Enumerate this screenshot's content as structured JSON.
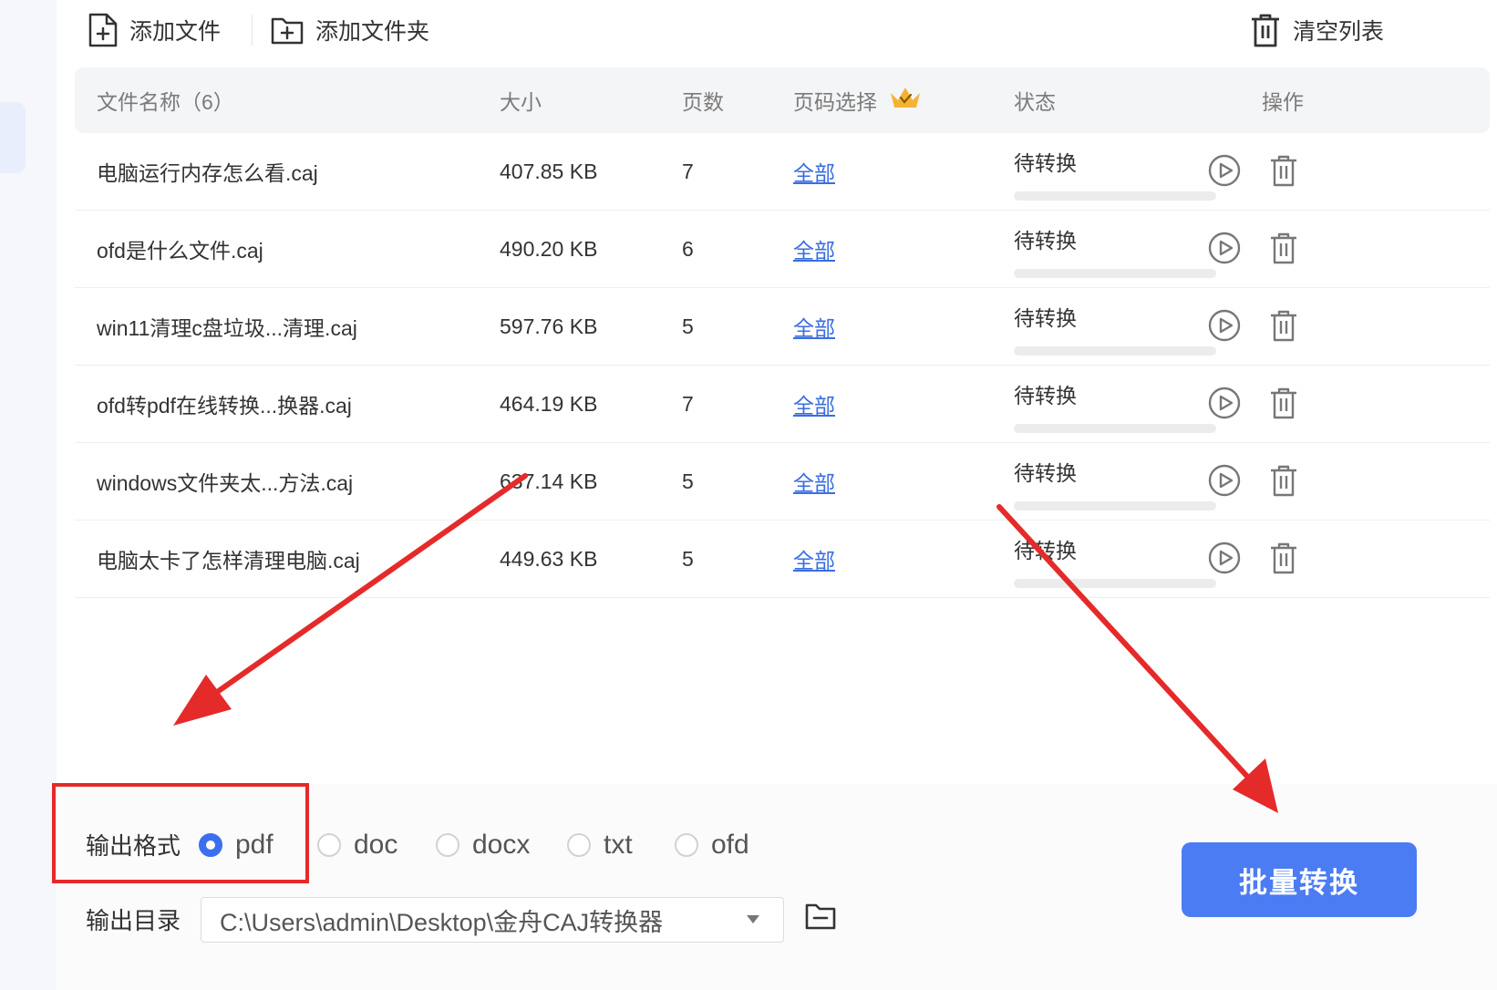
{
  "toolbar": {
    "add_file_label": "添加文件",
    "add_folder_label": "添加文件夹",
    "clear_list_label": "清空列表"
  },
  "table": {
    "headers": {
      "name": "文件名称（6）",
      "size": "大小",
      "pages": "页数",
      "range": "页码选择",
      "status": "状态",
      "ops": "操作"
    },
    "rows": [
      {
        "name": "电脑运行内存怎么看.caj",
        "size": "407.85 KB",
        "pages": "7",
        "range": "全部",
        "status": "待转换",
        "progress": 0
      },
      {
        "name": "ofd是什么文件.caj",
        "size": "490.20 KB",
        "pages": "6",
        "range": "全部",
        "status": "待转换",
        "progress": 0
      },
      {
        "name": "win11清理c盘垃圾...清理.caj",
        "size": "597.76 KB",
        "pages": "5",
        "range": "全部",
        "status": "待转换",
        "progress": 0
      },
      {
        "name": "ofd转pdf在线转换...换器.caj",
        "size": "464.19 KB",
        "pages": "7",
        "range": "全部",
        "status": "待转换",
        "progress": 0
      },
      {
        "name": "windows文件夹太...方法.caj",
        "size": "637.14 KB",
        "pages": "5",
        "range": "全部",
        "status": "待转换",
        "progress": 0
      },
      {
        "name": "电脑太卡了怎样清理电脑.caj",
        "size": "449.63 KB",
        "pages": "5",
        "range": "全部",
        "status": "待转换",
        "progress": 0
      }
    ]
  },
  "output": {
    "format_label": "输出格式",
    "formats": [
      "pdf",
      "doc",
      "docx",
      "txt",
      "ofd"
    ],
    "selected_format": "pdf",
    "dir_label": "输出目录",
    "dir_value": "C:\\Users\\admin\\Desktop\\金舟CAJ转换器"
  },
  "convert_button_label": "批量转换",
  "colors": {
    "accent": "#4c7cf4",
    "annotation_red": "#e52a2a",
    "link": "#3a6de0",
    "crown": "#f5b335"
  },
  "icons": {
    "add_file": "file-plus-icon",
    "add_folder": "folder-plus-icon",
    "clear_list": "trash-icon",
    "row_start": "play-circle-icon",
    "row_delete": "trash-icon",
    "premium": "crown-icon",
    "browse_dir": "folder-icon"
  }
}
